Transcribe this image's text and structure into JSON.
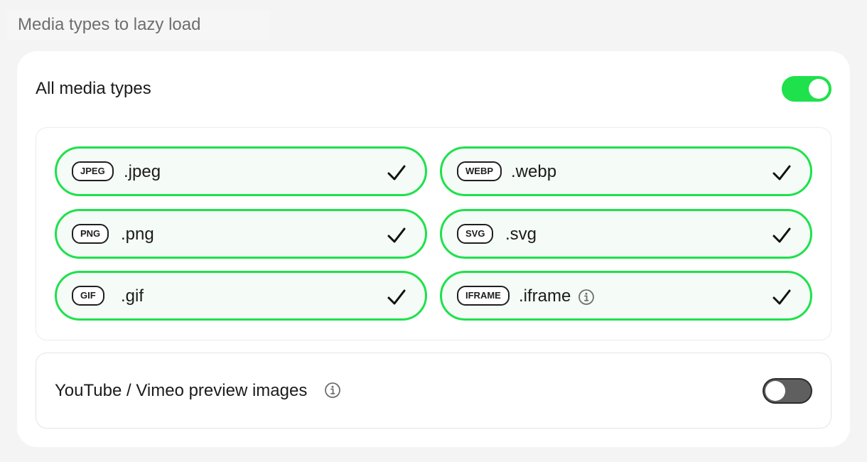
{
  "section": {
    "title": "Media types to lazy load"
  },
  "all_media": {
    "label": "All media types",
    "enabled": true,
    "toggle_color": "#1ee14c"
  },
  "media_types": [
    {
      "badge": "JPEG",
      "extension": ".jpeg",
      "checked": true,
      "info": false
    },
    {
      "badge": "WEBP",
      "extension": ".webp",
      "checked": true,
      "info": false
    },
    {
      "badge": "PNG",
      "extension": ".png",
      "checked": true,
      "info": false
    },
    {
      "badge": "SVG",
      "extension": ".svg",
      "checked": true,
      "info": false
    },
    {
      "badge": "GIF",
      "extension": ".gif",
      "checked": true,
      "info": false
    },
    {
      "badge": "IFRAME",
      "extension": ".iframe",
      "checked": true,
      "info": true,
      "info_icon": "info-icon"
    }
  ],
  "video_previews": {
    "label": "YouTube / Vimeo preview images",
    "enabled": false,
    "info_icon": "info-icon"
  },
  "icons": {
    "check": "check-icon",
    "info": "info-icon"
  },
  "colors": {
    "accent": "#1ee14c",
    "pill_background": "#f5fbf6",
    "toggle_off": "#5f5f5f",
    "heading_text": "#6e6e6e"
  }
}
